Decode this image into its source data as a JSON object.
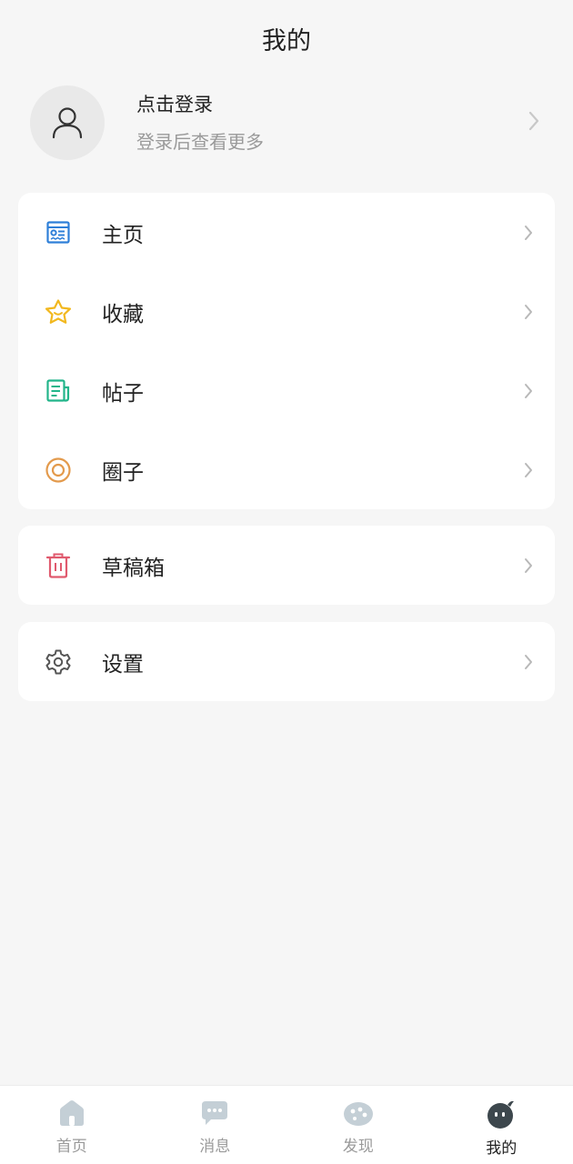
{
  "header": {
    "title": "我的"
  },
  "profile": {
    "login_title": "点击登录",
    "login_subtitle": "登录后查看更多"
  },
  "menu_group_1": [
    {
      "label": "主页",
      "icon": "homepage-icon",
      "color": "#2e7fd8"
    },
    {
      "label": "收藏",
      "icon": "star-icon",
      "color": "#f2b81e"
    },
    {
      "label": "帖子",
      "icon": "post-icon",
      "color": "#22b58a"
    },
    {
      "label": "圈子",
      "icon": "circle-icon",
      "color": "#e39a4c"
    }
  ],
  "menu_group_2": [
    {
      "label": "草稿箱",
      "icon": "trash-icon",
      "color": "#e05a6e"
    }
  ],
  "menu_group_3": [
    {
      "label": "设置",
      "icon": "gear-icon",
      "color": "#555555"
    }
  ],
  "tabbar": [
    {
      "label": "首页",
      "icon": "home-icon",
      "active": false
    },
    {
      "label": "消息",
      "icon": "message-icon",
      "active": false
    },
    {
      "label": "发现",
      "icon": "discover-icon",
      "active": false
    },
    {
      "label": "我的",
      "icon": "me-icon",
      "active": true
    }
  ],
  "colors": {
    "background": "#f6f6f6",
    "card": "#ffffff",
    "inactive_tab": "#c4cfd6",
    "active_tab": "#3d474d"
  }
}
